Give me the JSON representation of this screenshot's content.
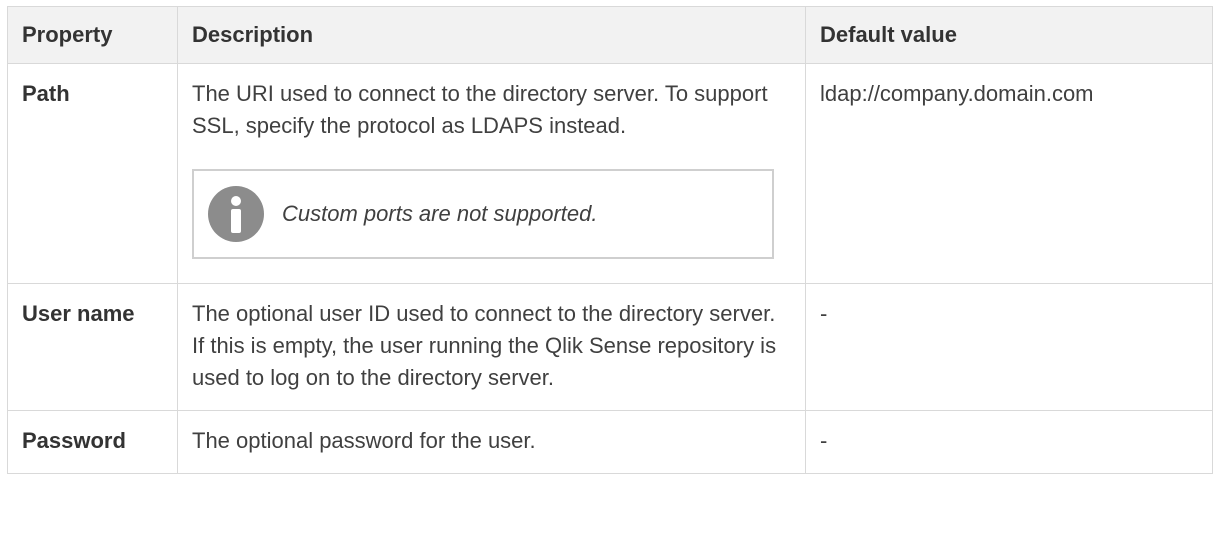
{
  "table": {
    "headers": {
      "property": "Property",
      "description": "Description",
      "default_value": "Default value"
    },
    "rows": [
      {
        "property": "Path",
        "description": "The URI used to connect to the directory server. To support SSL, specify the protocol as LDAPS instead.",
        "note": {
          "icon": "info-icon",
          "text": "Custom ports are not supported."
        },
        "default_value": "ldap://company.domain.com"
      },
      {
        "property": "User name",
        "description": "The optional user ID used to connect to the directory server. If this is empty, the user running the Qlik Sense repository is used to log on to the directory server.",
        "default_value": "-"
      },
      {
        "property": "Password",
        "description": "The optional password for the user.",
        "default_value": "-"
      }
    ]
  },
  "colors": {
    "header_bg": "#f2f2f2",
    "border": "#d9d9d9",
    "note_border": "#cfcfcf",
    "icon_gray": "#8c8c8c",
    "text": "#404040"
  }
}
